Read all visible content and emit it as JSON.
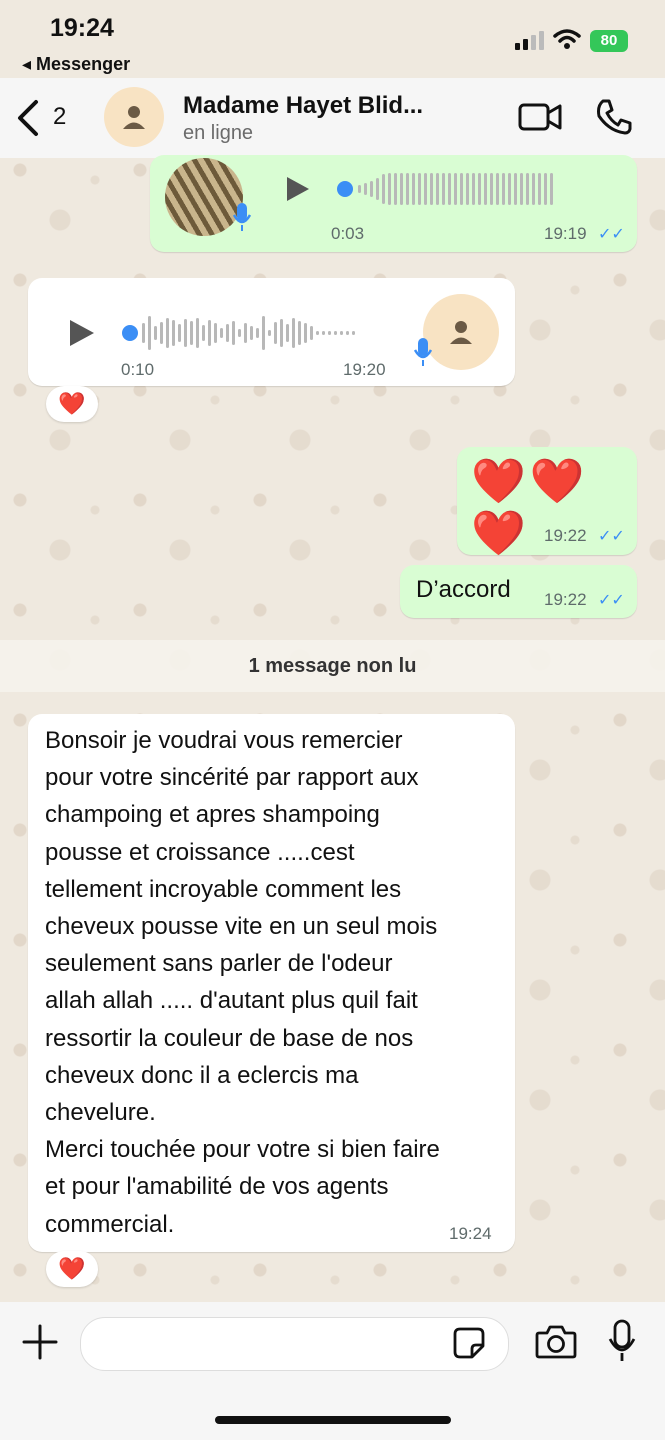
{
  "status_bar": {
    "time": "19:24",
    "back_app": "Messenger",
    "battery": "80"
  },
  "header": {
    "back_count": "2",
    "contact_name": "Madame Hayet Blid...",
    "contact_status": "en ligne"
  },
  "messages": [
    {
      "type": "voice",
      "direction": "out",
      "duration": "0:03",
      "time": "19:19",
      "ticks": "✓✓"
    },
    {
      "type": "voice",
      "direction": "in",
      "duration": "0:10",
      "time": "19:20",
      "reaction": "❤️"
    },
    {
      "type": "text",
      "direction": "out",
      "text": "❤️❤️❤️",
      "time": "19:22",
      "ticks": "✓✓"
    },
    {
      "type": "text",
      "direction": "out",
      "text": "D’accord",
      "time": "19:22",
      "ticks": "✓✓"
    }
  ],
  "unread_label": "1 message non lu",
  "incoming_long": {
    "lines": [
      "Bonsoir je voudrai vous remercier",
      "pour votre sincérité par rapport aux",
      "champoing et apres shampoing",
      "pousse et croissance .....cest",
      "tellement incroyable comment les",
      "cheveux pousse vite en un seul mois",
      "seulement sans parler de l'odeur",
      "allah allah ..... d'autant plus quil fait",
      "ressortir la couleur de base de nos",
      "cheveux donc il a eclercis ma",
      "chevelure.",
      "Merci touchée pour votre si bien faire",
      "et pour l'amabilité de vos agents",
      "commercial."
    ],
    "time": "19:24",
    "reaction": "❤️"
  },
  "input": {
    "placeholder": ""
  },
  "colors": {
    "outgoing": "#d9fdd3",
    "incoming": "#ffffff",
    "accent": "#3b8ef5",
    "battery": "#34c759"
  }
}
